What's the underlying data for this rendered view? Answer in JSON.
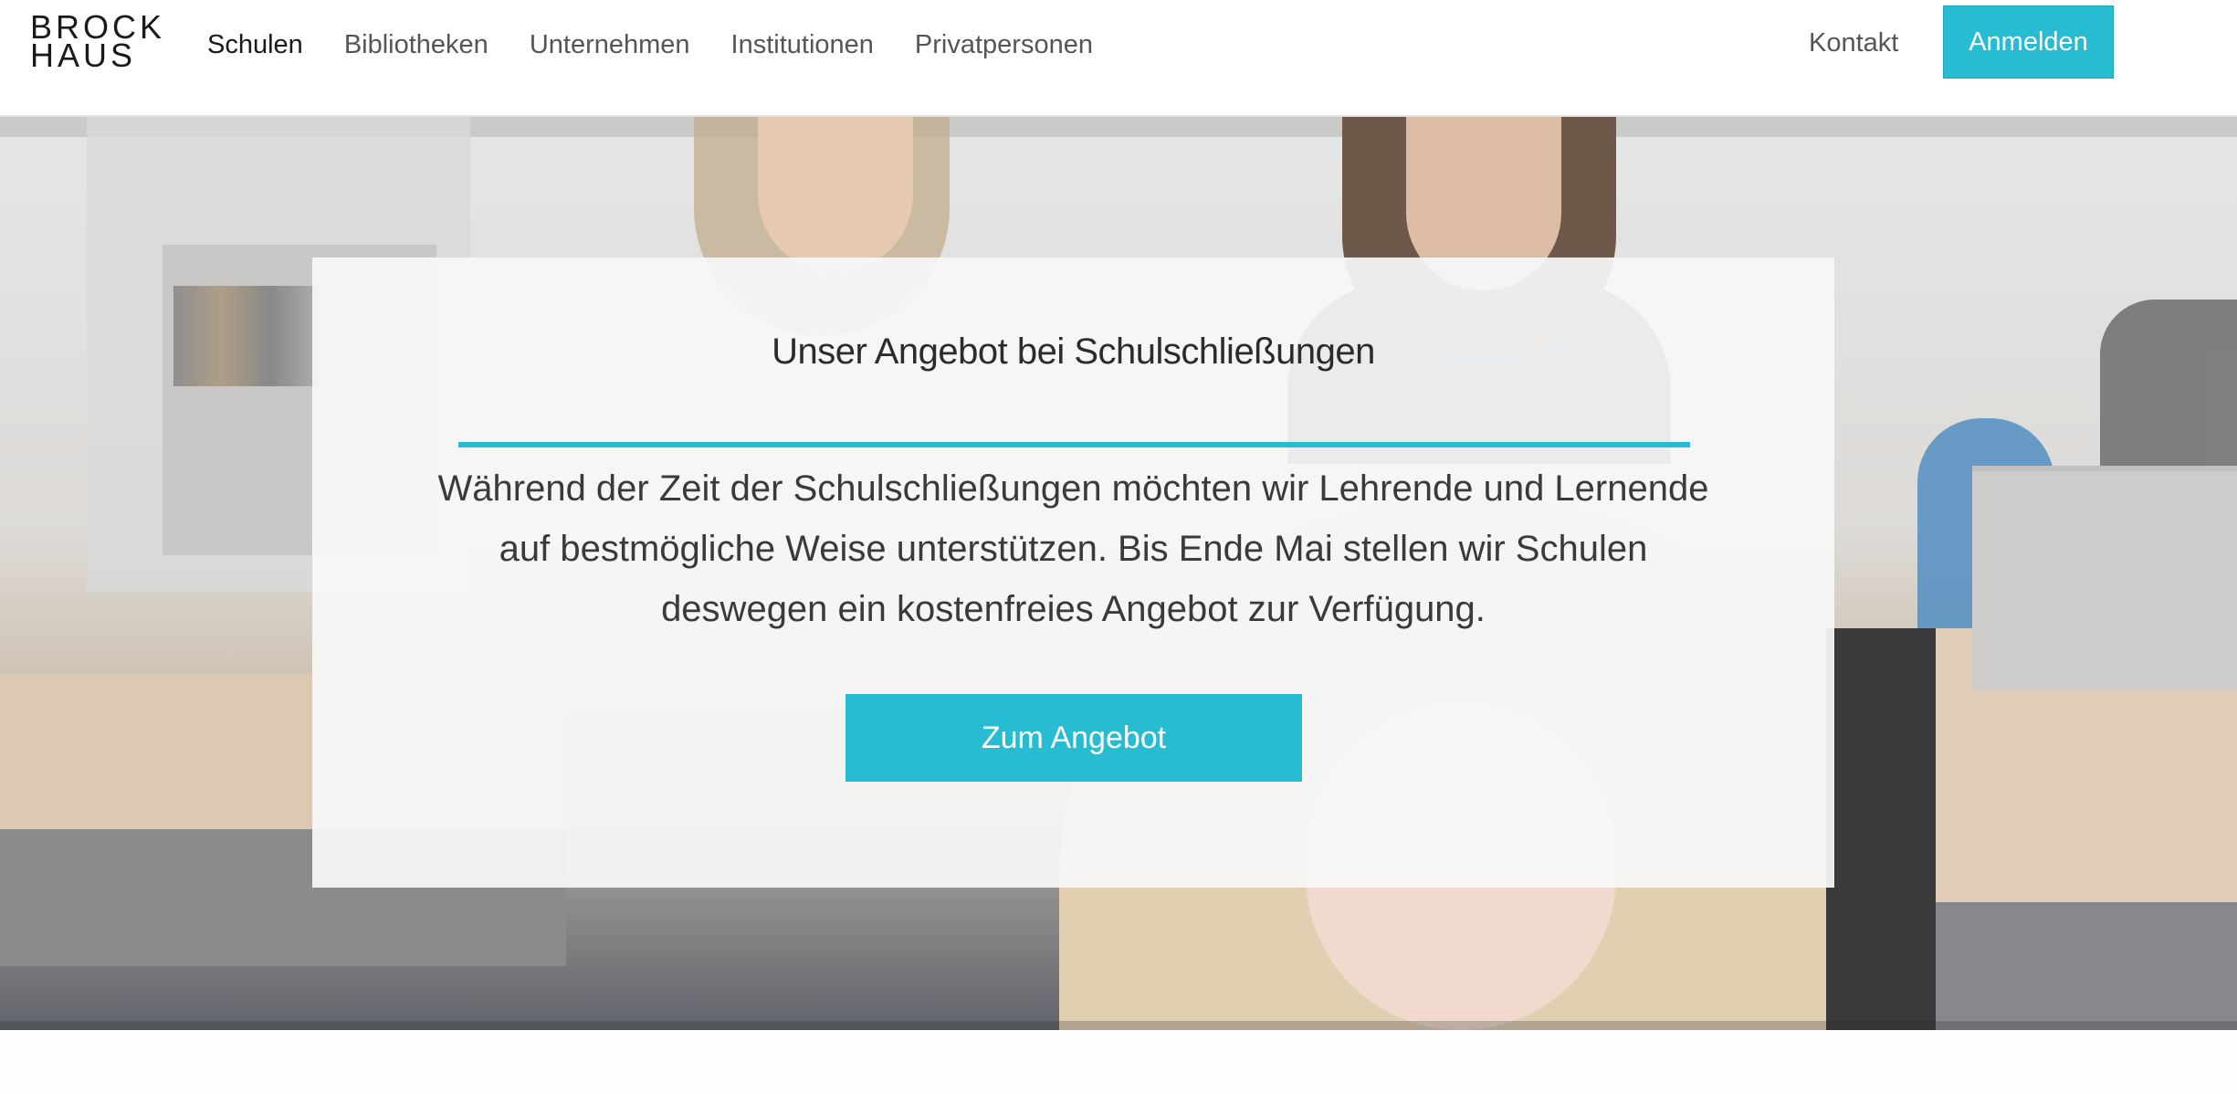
{
  "header": {
    "logo_line1": "BROCK",
    "logo_line2": "HAUS",
    "nav": [
      {
        "label": "Schulen",
        "active": true
      },
      {
        "label": "Bibliotheken",
        "active": false
      },
      {
        "label": "Unternehmen",
        "active": false
      },
      {
        "label": "Institutionen",
        "active": false
      },
      {
        "label": "Privatpersonen",
        "active": false
      }
    ],
    "contact_label": "Kontakt",
    "login_label": "Anmelden"
  },
  "hero": {
    "title": "Unser Angebot bei Schulschließungen",
    "text": "Während der Zeit der Schulschließungen möchten wir Lehrende und Lernende auf bestmögliche Weise unterstützen. Bis Ende Mai stellen wir Schulen deswegen ein kostenfreies Angebot zur Verfügung.",
    "button_label": "Zum Angebot"
  },
  "colors": {
    "accent": "#28bcd2",
    "text_dark": "#2c2c2c",
    "nav_text": "#555555"
  }
}
